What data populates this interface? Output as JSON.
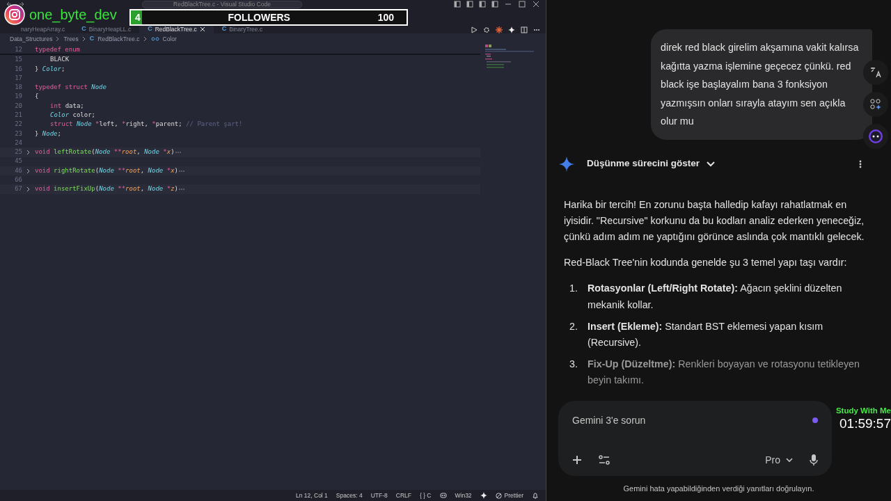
{
  "overlay": {
    "handle": "one_byte_dev",
    "followers": {
      "count": "4",
      "label": "FOLLOWERS",
      "goal": "100",
      "level": 0.04
    },
    "timer": {
      "label": "Study With Me",
      "time": "01:59:57"
    }
  },
  "editor": {
    "window_title": "RedBlackTree.c - Visual Studio Code",
    "tabs": [
      {
        "label": "naryHeapArray.c",
        "selected": false
      },
      {
        "icon": "C",
        "label": "BinaryHeapLL.c",
        "selected": false
      },
      {
        "icon": "C",
        "label": "RedBlackTree.c",
        "selected": true
      },
      {
        "icon": "C",
        "label": "BinaryTree.c",
        "selected": false
      }
    ],
    "breadcrumb": [
      {
        "label": "Data_Structures"
      },
      {
        "label": "Trees"
      },
      {
        "icon": "C",
        "label": "RedBlackTree.c"
      },
      {
        "label": "Color"
      }
    ],
    "lines": [
      {
        "number": "12",
        "indented": false,
        "folded": false,
        "sticky": true,
        "tokens": [
          {
            "kind": "kw",
            "text": "typedef enum"
          }
        ]
      },
      {
        "number": "15",
        "indented": true,
        "folded": false,
        "sticky": false,
        "tokens": [
          {
            "kind": "plain",
            "text": "BLACK"
          }
        ]
      },
      {
        "number": "16",
        "indented": false,
        "folded": false,
        "sticky": false,
        "tokens": [
          {
            "kind": "plain",
            "text": "} "
          },
          {
            "kind": "type",
            "text": "Color"
          },
          {
            "kind": "plain",
            "text": ";"
          }
        ]
      },
      {
        "number": "17",
        "folded": false,
        "sticky": false
      },
      {
        "number": "18",
        "indented": false,
        "folded": false,
        "sticky": false,
        "tokens": [
          {
            "kind": "kw",
            "text": "typedef struct "
          },
          {
            "kind": "type",
            "text": "Node"
          }
        ]
      },
      {
        "number": "19",
        "indented": false,
        "folded": false,
        "sticky": false,
        "tokens": [
          {
            "kind": "plain",
            "text": "{"
          }
        ]
      },
      {
        "number": "20",
        "indented": true,
        "folded": false,
        "sticky": false,
        "tokens": [
          {
            "kind": "kw",
            "text": "int"
          },
          {
            "kind": "plain",
            "text": " data;"
          }
        ]
      },
      {
        "number": "21",
        "indented": true,
        "folded": false,
        "sticky": false,
        "tokens": [
          {
            "kind": "type",
            "text": "Color"
          },
          {
            "kind": "plain",
            "text": " color;"
          }
        ]
      },
      {
        "number": "22",
        "indented": true,
        "folded": false,
        "sticky": false,
        "tokens": [
          {
            "kind": "kw",
            "text": "struct "
          },
          {
            "kind": "type",
            "text": "Node"
          },
          {
            "kind": "op",
            "text": " *"
          },
          {
            "kind": "plain",
            "text": "left, "
          },
          {
            "kind": "op",
            "text": "*"
          },
          {
            "kind": "plain",
            "text": "right, "
          },
          {
            "kind": "op",
            "text": "*"
          },
          {
            "kind": "plain",
            "text": "parent; "
          },
          {
            "kind": "comment",
            "text": "// Parent şart!"
          }
        ]
      },
      {
        "number": "23",
        "indented": false,
        "folded": false,
        "sticky": false,
        "tokens": [
          {
            "kind": "plain",
            "text": "} "
          },
          {
            "kind": "type",
            "text": "Node"
          },
          {
            "kind": "plain",
            "text": ";"
          }
        ]
      },
      {
        "number": "24",
        "folded": false,
        "sticky": false
      },
      {
        "number": "25",
        "indented": false,
        "folded": true,
        "sticky": false,
        "tokens": [
          {
            "kind": "kw",
            "text": "void "
          },
          {
            "kind": "fn",
            "text": "leftRotate"
          },
          {
            "kind": "plain",
            "text": "("
          },
          {
            "kind": "type",
            "text": "Node"
          },
          {
            "kind": "op",
            "text": " **"
          },
          {
            "kind": "param",
            "text": "root"
          },
          {
            "kind": "plain",
            "text": ", "
          },
          {
            "kind": "type",
            "text": "Node"
          },
          {
            "kind": "op",
            "text": " *"
          },
          {
            "kind": "param",
            "text": "x"
          },
          {
            "kind": "plain",
            "text": ")"
          }
        ]
      },
      {
        "number": "45",
        "folded": false,
        "sticky": false
      },
      {
        "number": "46",
        "indented": false,
        "folded": true,
        "sticky": false,
        "tokens": [
          {
            "kind": "kw",
            "text": "void "
          },
          {
            "kind": "fn",
            "text": "rightRotate"
          },
          {
            "kind": "plain",
            "text": "("
          },
          {
            "kind": "type",
            "text": "Node"
          },
          {
            "kind": "op",
            "text": " **"
          },
          {
            "kind": "param",
            "text": "root"
          },
          {
            "kind": "plain",
            "text": ", "
          },
          {
            "kind": "type",
            "text": "Node"
          },
          {
            "kind": "op",
            "text": " *"
          },
          {
            "kind": "param",
            "text": "x"
          },
          {
            "kind": "plain",
            "text": ")"
          }
        ]
      },
      {
        "number": "66",
        "folded": false,
        "sticky": false
      },
      {
        "number": "67",
        "indented": false,
        "folded": true,
        "sticky": false,
        "tokens": [
          {
            "kind": "kw",
            "text": "void "
          },
          {
            "kind": "fn",
            "text": "insertFixUp"
          },
          {
            "kind": "plain",
            "text": "("
          },
          {
            "kind": "type",
            "text": "Node"
          },
          {
            "kind": "op",
            "text": " **"
          },
          {
            "kind": "param",
            "text": "root"
          },
          {
            "kind": "plain",
            "text": ", "
          },
          {
            "kind": "type",
            "text": "Node"
          },
          {
            "kind": "op",
            "text": " *"
          },
          {
            "kind": "param",
            "text": "z"
          },
          {
            "kind": "plain",
            "text": ")"
          }
        ]
      }
    ],
    "status_bar": {
      "position": "Ln 12, Col 1",
      "spaces": "Spaces: 4",
      "encoding": "UTF-8",
      "eol": "CRLF",
      "language": "{ } C",
      "platform": "Win32",
      "formatter": "Prettier"
    }
  },
  "chat": {
    "user_message": "direk red black girelim akşamına vakit kalırsa kağıtta yazma işlemine geçecez çünkü. red black işe başlayalım bana 3 fonksiyon yazmışsın onları sırayla atayım sen açıkla olur mu",
    "thinking_toggle": "Düşünme sürecini göster",
    "paragraphs": [
      "Harika bir tercih! En zorunu başta halledip kafayı rahatlatmak en iyisidir. \"Recursive\" korkunu da bu kodları analiz ederken yeneceğiz, çünkü adım adım ne yaptığını görünce aslında çok mantıklı gelecek.",
      "Red-Black Tree'nin kodunda genelde şu 3 temel yapı taşı vardır:"
    ],
    "list": [
      {
        "number": "1.",
        "text": "**Rotasyonlar (Left/Right Rotate):** Ağacın şeklini düzelten mekanik kollar."
      },
      {
        "number": "2.",
        "text": "**Insert (Ekleme):** Standart BST eklemesi yapan kısım (Recursive)."
      },
      {
        "number": "3.",
        "text": "**Fix-Up (Düzeltme):** Renkleri boyayan ve rotasyonu tetikleyen beyin takımı."
      }
    ],
    "input": {
      "placeholder": "Gemini 3'e sorun",
      "model": "Pro"
    },
    "disclaimer": "Gemini hata yapabildiğinden verdiği yanıtları doğrulayın."
  }
}
